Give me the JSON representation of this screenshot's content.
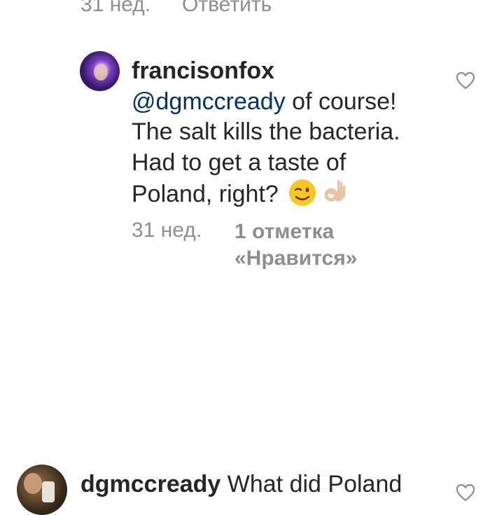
{
  "previous_comment": {
    "time": "31 нед.",
    "reply_label": "Ответить"
  },
  "comment": {
    "username": "francisonfox",
    "mention": "@dgmccready",
    "line1_rest": " of course!",
    "line2": "The salt kills the bacteria.",
    "line3": "Had to get a taste of",
    "line4": "Poland, right? ",
    "emojis": [
      "winking-face-emoji",
      "ok-hand-emoji"
    ],
    "time": "31 нед.",
    "likes_line1": "1 отметка",
    "likes_line2": "«Нравится»"
  },
  "next_comment": {
    "username": "dgmccready",
    "text": " What did Poland"
  },
  "colors": {
    "mention": "#003569",
    "meta": "#8e8e8e",
    "text": "#262626"
  },
  "icons": [
    "heart-icon",
    "heart-icon"
  ]
}
